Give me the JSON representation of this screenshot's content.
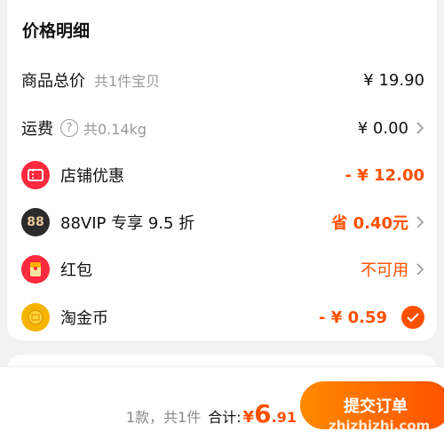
{
  "card": {
    "title": "价格明细",
    "rows": [
      {
        "label": "商品总价",
        "sub": "共1件宝贝",
        "value": "¥ 19.90"
      },
      {
        "label": "运费",
        "sub": "共0.14kg",
        "value": "¥ 0.00"
      },
      {
        "label": "店铺优惠",
        "value": "- ¥ 12.00"
      },
      {
        "label": "88VIP 专享 9.5 折",
        "value": "省 0.40元",
        "badge": "88"
      },
      {
        "label": "红包",
        "value": "不可用"
      },
      {
        "label": "淘金币",
        "value": "- ¥ 0.59"
      }
    ]
  },
  "bottom": {
    "count": "1款，共1件",
    "total_label": "合计:",
    "currency": "¥",
    "total_int": "6",
    "total_dec": ".91",
    "submit_label": "提交订单"
  },
  "watermark": "zhizhizhi.com",
  "colors": {
    "accent": "#ff5000",
    "coupon": "#ff2a3d",
    "vip": "#2b2b2b",
    "coin": "#f5b400"
  },
  "icons": [
    "help-icon",
    "store-coupon-icon",
    "vip88-icon",
    "red-packet-icon",
    "gold-coin-icon",
    "check-icon",
    "chevron-right-icon"
  ]
}
